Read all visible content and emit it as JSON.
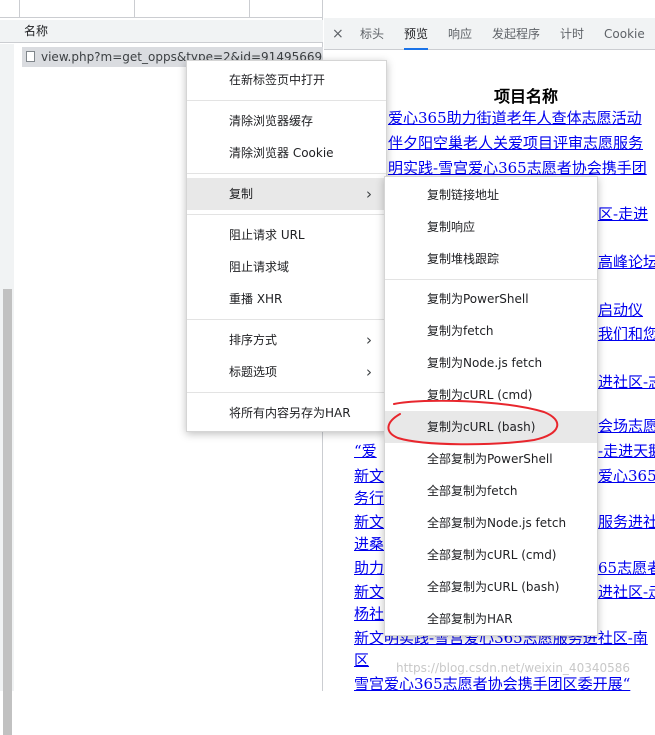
{
  "list": {
    "header_name": "名称",
    "request": "view.php?m=get_opps&type=2&id=91495669&p..."
  },
  "tabs": {
    "close": "×",
    "items": [
      "标头",
      "预览",
      "响应",
      "发起程序",
      "计时",
      "Cookie"
    ],
    "active_index": 1
  },
  "preview": {
    "column_title": "项目名称",
    "lines": [
      "爱心365助力街道老年人查体志愿活动",
      "伴夕阳空巢老人关爱项目评审志愿服务",
      "明实践-雪宫爱心365志愿者协会携手团",
      "区-走进",
      "高峰论坛",
      "启动仪",
      "我们和您",
      "进社区-志",
      "会场志愿",
      "“爱",
      "-走进天鹅",
      "新文",
      "爱心365",
      "务行",
      "新文",
      "服务进社",
      "进桑",
      "助力",
      "65志愿者",
      "新文",
      "进社区-走",
      "杨社",
      "新文明实践-雪宫爱心365志愿服务进社区-南",
      "区",
      "雪宫爱心365志愿者协会携手团区委开展“"
    ]
  },
  "main_menu": {
    "items": [
      {
        "label": "在新标签页中打开",
        "submenu": false
      },
      {
        "label": "清除浏览器缓存",
        "submenu": false
      },
      {
        "label": "清除浏览器 Cookie",
        "submenu": false
      },
      {
        "label": "复制",
        "submenu": true
      },
      {
        "label": "阻止请求 URL",
        "submenu": false
      },
      {
        "label": "阻止请求域",
        "submenu": false
      },
      {
        "label": "重播 XHR",
        "submenu": false
      },
      {
        "label": "排序方式",
        "submenu": true
      },
      {
        "label": "标题选项",
        "submenu": true
      },
      {
        "label": "将所有内容另存为HAR",
        "submenu": false
      }
    ],
    "highlighted": "复制"
  },
  "copy_submenu": {
    "items": [
      "复制链接地址",
      "复制响应",
      "复制堆栈跟踪",
      "复制为PowerShell",
      "复制为fetch",
      "复制为Node.js fetch",
      "复制为cURL (cmd)",
      "复制为cURL (bash)",
      "全部复制为PowerShell",
      "全部复制为fetch",
      "全部复制为Node.js fetch",
      "全部复制为cURL (cmd)",
      "全部复制为cURL (bash)",
      "全部复制为HAR"
    ],
    "highlighted": "复制为cURL (bash)"
  },
  "watermark": "https://blog.csdn.net/weixin_40340586",
  "colors": {
    "annotation": "#e8262d",
    "link": "#0000ee",
    "accent": "#1a73e8"
  },
  "icons": {
    "submenu_arrow": "chevron-right-icon",
    "close": "close-icon",
    "file": "file-icon"
  }
}
